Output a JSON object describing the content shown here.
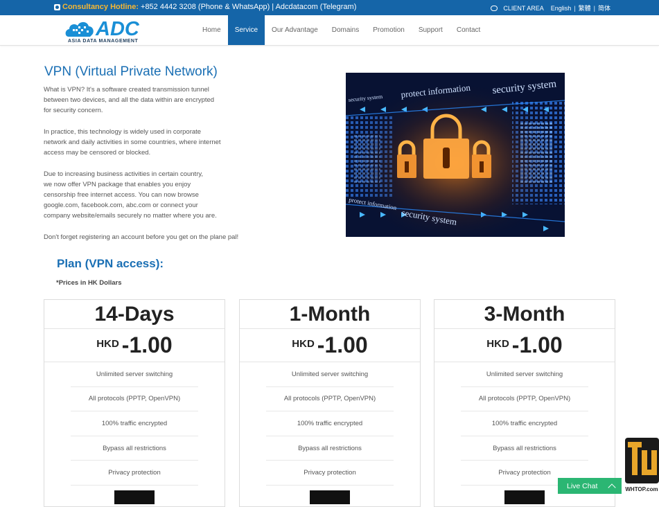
{
  "topbar": {
    "hotline_label": "Consultancy Hotline:",
    "hotline_text": "+852 4442 3208 (Phone & WhatsApp) | Adcdatacom (Telegram)",
    "client_area": "CLIENT AREA",
    "languages": [
      "English",
      "繁體",
      "简体"
    ]
  },
  "logo": {
    "word": "ADC",
    "tagline": "ASIA DATA MANAGEMENT"
  },
  "nav": {
    "items": [
      {
        "label": "Home",
        "active": false
      },
      {
        "label": "Service",
        "active": true
      },
      {
        "label": "Our Advantage",
        "active": false
      },
      {
        "label": "Domains",
        "active": false
      },
      {
        "label": "Promotion",
        "active": false
      },
      {
        "label": "Support",
        "active": false
      },
      {
        "label": "Contact",
        "active": false
      }
    ]
  },
  "hero": {
    "title": "VPN (Virtual Private Network)",
    "paragraphs": [
      [
        "What is VPN? It's a software created transmission tunnel",
        "between two devices, and all the data within are encrypted",
        "for security concern."
      ],
      [
        "In practice, this technology is widely used in corporate",
        "network and daily activities in some countries, where internet",
        "access may be censored or blocked."
      ],
      [
        "Due to increasing business activities in certain country,",
        "we now offer VPN package that enables you enjoy",
        "censorship free internet access. You can now browse",
        "google.com, facebook.com, abc.com or connect your",
        "company website/emails securely no matter where you are."
      ],
      [
        "Don't forget registering an account before you get on the plane pal!"
      ]
    ],
    "image_texts": [
      "protect information",
      "security system",
      "security system",
      "protect information",
      "security system"
    ]
  },
  "plans": {
    "title": "Plan (VPN access):",
    "note": "*Prices in HK Dollars",
    "cards": [
      {
        "name": "14-Days",
        "currency": "HKD",
        "amount": "-1.00"
      },
      {
        "name": "1-Month",
        "currency": "HKD",
        "amount": "-1.00"
      },
      {
        "name": "3-Month",
        "currency": "HKD",
        "amount": "-1.00"
      }
    ],
    "features": [
      "Unlimited server switching",
      "All protocols (PPTP, OpenVPN)",
      "100% traffic encrypted",
      "Bypass all restrictions",
      "Privacy protection"
    ]
  },
  "livechat": {
    "label": "Live Chat"
  },
  "watermark": {
    "text": "WHTOP.com"
  },
  "colors": {
    "primary": "#1565a8",
    "accent": "#f7b733",
    "title": "#1a6fb4",
    "chat": "#2bb673"
  }
}
